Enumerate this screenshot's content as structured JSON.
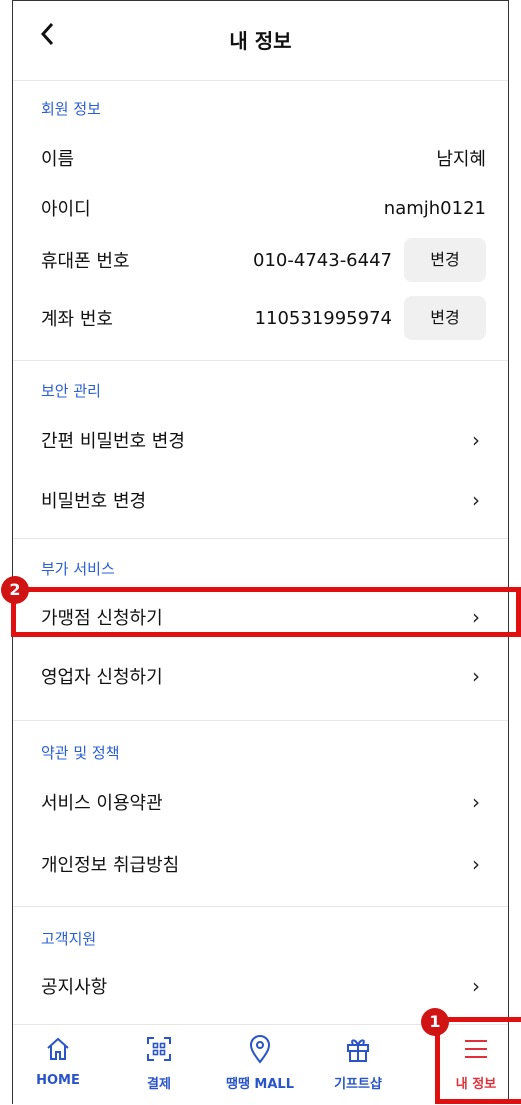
{
  "header": {
    "title": "내 정보",
    "back_icon": "chevron-left-icon"
  },
  "member": {
    "section_title": "회원 정보",
    "name_label": "이름",
    "name_value": "남지혜",
    "id_label": "아이디",
    "id_value": "namjh0121",
    "phone_label": "휴대폰 번호",
    "phone_value": "010-4743-6447",
    "phone_change": "변경",
    "account_label": "계좌 번호",
    "account_value": "110531995974",
    "account_change": "변경"
  },
  "security": {
    "section_title": "보안 관리",
    "items": [
      {
        "label": "간편 비밀번호 변경"
      },
      {
        "label": "비밀번호 변경"
      }
    ]
  },
  "extra": {
    "section_title": "부가 서비스",
    "items": [
      {
        "label": "가맹점 신청하기"
      },
      {
        "label": "영업자 신청하기"
      }
    ]
  },
  "terms": {
    "section_title": "약관 및 정책",
    "items": [
      {
        "label": "서비스 이용약관"
      },
      {
        "label": "개인정보 취급방침"
      }
    ]
  },
  "support": {
    "section_title": "고객지원",
    "items": [
      {
        "label": "공지사항"
      }
    ]
  },
  "badges": {
    "one": "1",
    "two": "2"
  },
  "tabbar": {
    "tabs": [
      {
        "label": "HOME",
        "icon": "home-icon"
      },
      {
        "label": "결제",
        "icon": "qr-scan-icon"
      },
      {
        "label": "땡땡 MALL",
        "icon": "map-pin-icon"
      },
      {
        "label": "기프트샵",
        "icon": "gift-icon"
      },
      {
        "label": "내 정보",
        "icon": "menu-icon"
      }
    ],
    "active_color": "#e0313a",
    "color": "#2a55c8"
  },
  "highlight_color": "#e01010"
}
